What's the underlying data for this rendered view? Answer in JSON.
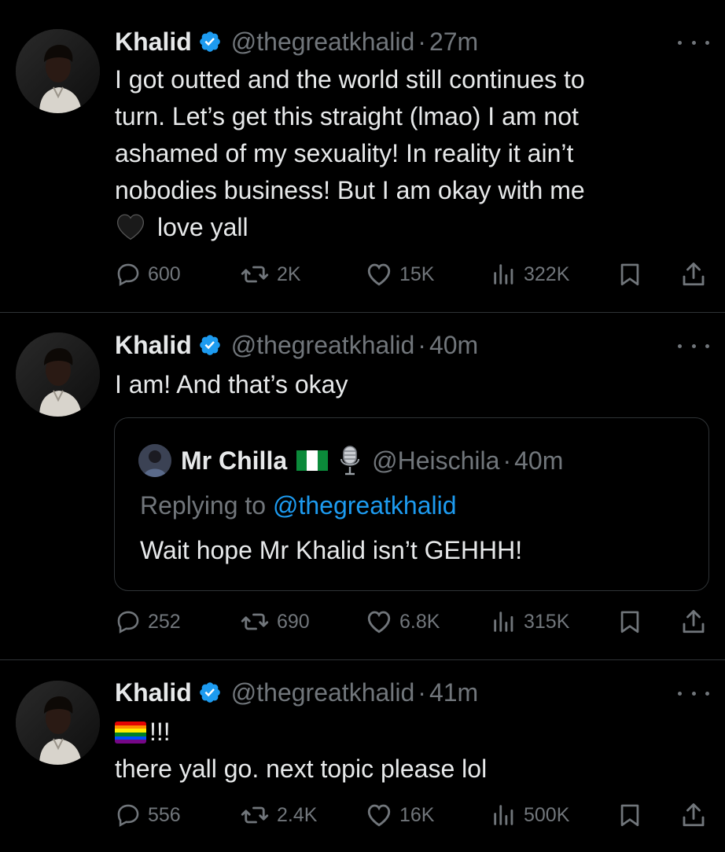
{
  "tweets": [
    {
      "name": "Khalid",
      "handle": "@thegreatkhalid",
      "time": "27m",
      "text_lines": [
        "I got outted and the world still continues to",
        "turn. Let’s get this straight (lmao) I am not",
        "ashamed of my sexuality! In reality it ain’t",
        "nobodies business! But I am okay with me"
      ],
      "text_last": "love yall",
      "replies": "600",
      "retweets": "2K",
      "likes": "15K",
      "views": "322K"
    },
    {
      "name": "Khalid",
      "handle": "@thegreatkhalid",
      "time": "40m",
      "text": "I am! And that’s okay",
      "quote": {
        "name": "Mr Chilla",
        "handle": "@Heischila",
        "time": "40m",
        "replying_prefix": "Replying to",
        "replying_to": "@thegreatkhalid",
        "text": "Wait hope Mr Khalid isn’t GEHHH!"
      },
      "replies": "252",
      "retweets": "690",
      "likes": "6.8K",
      "views": "315K"
    },
    {
      "name": "Khalid",
      "handle": "@thegreatkhalid",
      "time": "41m",
      "text_emoji_line": "!!!",
      "text": "there yall go. next topic please lol",
      "replies": "556",
      "retweets": "2.4K",
      "likes": "16K",
      "views": "500K"
    }
  ],
  "colors": {
    "background": "#000000",
    "text": "#e7e9ea",
    "muted": "#71767b",
    "accent": "#1d9bf0",
    "divider": "#2f3336"
  },
  "icons": [
    "verified-badge-icon",
    "more-icon",
    "reply-icon",
    "retweet-icon",
    "like-icon",
    "views-icon",
    "bookmark-icon",
    "share-icon",
    "black-heart-emoji",
    "nigeria-flag-emoji",
    "microphone-emoji",
    "rainbow-flag-emoji"
  ]
}
